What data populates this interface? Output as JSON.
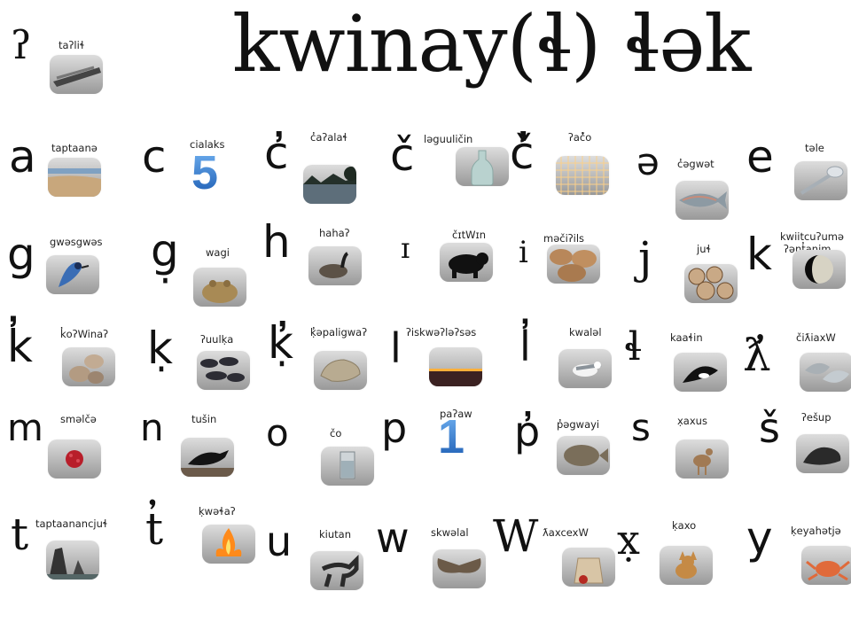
{
  "title": "kwinay(ɬ) ɬək",
  "letters": [
    {
      "glyph": "ʔ",
      "word": "taʔliɬ",
      "icon": "canoe-photo"
    },
    {
      "glyph": "a",
      "word": "taptaanə",
      "icon": "beach-photo"
    },
    {
      "glyph": "c",
      "word": "cialaks",
      "icon": "number-five-graphic",
      "numeral": "5"
    },
    {
      "glyph": "c̓",
      "word": "c̓aʔalaɬ",
      "icon": "lake-photo"
    },
    {
      "glyph": "č",
      "word": "ləguuličin",
      "icon": "bottle-photo"
    },
    {
      "glyph": "č̓",
      "word": "ʔač̓o",
      "icon": "honeycomb-photo"
    },
    {
      "glyph": "ə",
      "word": "c̓əgwət",
      "icon": "salmon-photo"
    },
    {
      "glyph": "e",
      "word": "təle",
      "icon": "spoon-photo"
    },
    {
      "glyph": "g",
      "word": "gwəsgwəs",
      "icon": "jay-photo"
    },
    {
      "glyph": "g̣",
      "word": "wagi",
      "icon": "frog-photo"
    },
    {
      "glyph": "h",
      "word": "hahaʔ",
      "icon": "goose-photo"
    },
    {
      "glyph": "ɪ",
      "word": "čɪtWɪn",
      "icon": "bear-photo"
    },
    {
      "glyph": "i",
      "word": "məčiʔils",
      "icon": "potato-photo"
    },
    {
      "glyph": "j",
      "word": "juɬ",
      "icon": "firewood-photo"
    },
    {
      "glyph": "k",
      "word": "kwiitcuʔumə",
      "word2": "ʔənt̓anim",
      "icon": "moon-photo"
    },
    {
      "glyph": "k̓",
      "word": "k̓oʔWinaʔ",
      "icon": "clams-photo"
    },
    {
      "glyph": "ḳ",
      "word": "ʔuulḳa",
      "icon": "mussels-photo"
    },
    {
      "glyph": "ḳ̓",
      "word": "ḳ̓əpaligwaʔ",
      "icon": "oyster-photo"
    },
    {
      "glyph": "l",
      "word": "ʔiskwəʔləʔsəs",
      "icon": "sunset-photo"
    },
    {
      "glyph": "l̓",
      "word": "kwaləl",
      "icon": "gull-photo"
    },
    {
      "glyph": "ɬ",
      "word": "kaaɬin",
      "icon": "orca-photo"
    },
    {
      "glyph": "ƛ̓",
      "word": "čiƛiaxW",
      "icon": "oysters-photo"
    },
    {
      "glyph": "m",
      "word": "sməlčə",
      "icon": "raspberry-photo"
    },
    {
      "glyph": "n",
      "word": "tušin",
      "icon": "crow-photo"
    },
    {
      "glyph": "o",
      "word": "čo",
      "icon": "water-glass-photo"
    },
    {
      "glyph": "p",
      "word": "paʔaw",
      "icon": "number-one-graphic",
      "numeral": "1"
    },
    {
      "glyph": "p̓",
      "word": "p̓əgwayi",
      "icon": "flounder-photo"
    },
    {
      "glyph": "s",
      "word": "x̣axus",
      "icon": "deer-photo"
    },
    {
      "glyph": "š",
      "word": "ʔešup",
      "icon": "seal-photo"
    },
    {
      "glyph": "t",
      "word": "taptaanancjuɬ",
      "icon": "sea-stacks-photo"
    },
    {
      "glyph": "t̓",
      "word": "ḳwəɬaʔ",
      "icon": "campfire-photo"
    },
    {
      "glyph": "u",
      "word": "kiutan",
      "icon": "horse-photo"
    },
    {
      "glyph": "w",
      "word": "skwəlal",
      "icon": "moth-photo"
    },
    {
      "glyph": "W",
      "word": "ƛaxcexW",
      "icon": "bag-photo"
    },
    {
      "glyph": "x̣",
      "word": "ḳaxo",
      "icon": "dog-photo"
    },
    {
      "glyph": "y",
      "word": "ḳeyahətjə",
      "icon": "crab-photo"
    }
  ]
}
